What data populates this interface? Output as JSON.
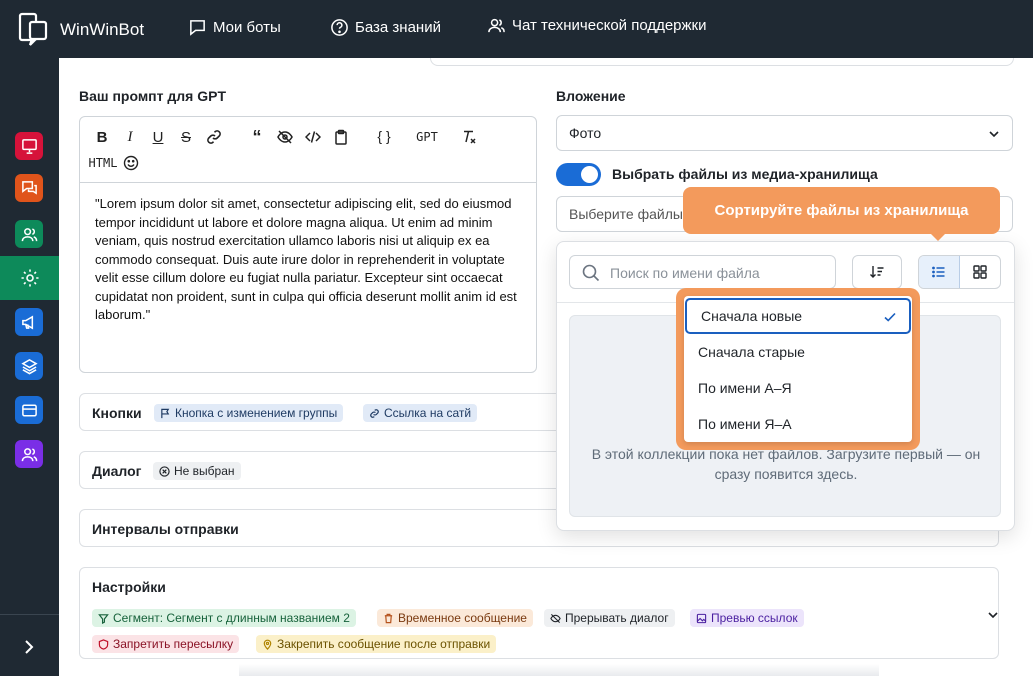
{
  "app": {
    "brand": "WinWinBot"
  },
  "nav": {
    "my_bots": "Мои боты",
    "knowledge_base": "База знаний",
    "support_chat": "Чат технической поддержки"
  },
  "sidebar": {
    "items": [
      {
        "icon": "presentation-icon",
        "color": "#d6123a"
      },
      {
        "icon": "chat-icon",
        "color": "#e0541b"
      },
      {
        "icon": "users-icon",
        "color": "#0d8a5a"
      },
      {
        "icon": "gear-icon",
        "color": "#0d8a5a",
        "active": true
      },
      {
        "icon": "megaphone-icon",
        "color": "#1a6cd6"
      },
      {
        "icon": "layers-icon",
        "color": "#1a6cd6"
      },
      {
        "icon": "card-icon",
        "color": "#1a6cd6"
      },
      {
        "icon": "group-icon",
        "color": "#7a2ee6"
      }
    ]
  },
  "prompt": {
    "label": "Ваш промпт для GPT",
    "toolbar": {
      "gpt_label": "GPT",
      "html_label": "HTML"
    },
    "text": "\"Lorem ipsum dolor sit amet, consectetur adipiscing elit, sed do eiusmod tempor incididunt ut labore et dolore magna aliqua. Ut enim ad minim veniam, quis nostrud exercitation ullamco laboris nisi ut aliquip ex ea commodo consequat. Duis aute irure dolor in reprehenderit in voluptate velit esse cillum dolore eu fugiat nulla pariatur. Excepteur sint occaecat cupidatat non proident, sunt in culpa qui officia deserunt mollit anim id est laborum.\""
  },
  "buttons_row": {
    "title": "Кнопки",
    "chips": [
      "Кнопка с изменением группы",
      "Ссылка на сатй"
    ]
  },
  "dialog_row": {
    "title": "Диалог",
    "chip": "Не выбран"
  },
  "intervals_row": {
    "title": "Интервалы отправки"
  },
  "settings_row": {
    "title": "Настройки",
    "chips": [
      "Сегмент: Сегмент с длинным названием 2",
      "Временное сообщение",
      "Прерывать диалог",
      "Превью ссылок",
      "Запретить пересылку",
      "Закрепить сообщение после отправки"
    ]
  },
  "attachment": {
    "label": "Вложение",
    "value": "Фото",
    "toggle_label": "Выбрать файлы из медиа-хранилища",
    "toggle_on": true,
    "files_placeholder": "Выберите файлы"
  },
  "storage": {
    "search_placeholder": "Поиск по имени файла",
    "empty_text": "В этой коллекции пока нет файлов. Загрузите первый — он сразу появится здесь.",
    "sort_options": [
      "Сначала новые",
      "Сначала старые",
      "По имени А–Я",
      "По имени Я–А"
    ],
    "selected_sort": "Сначала новые"
  },
  "tooltip": {
    "text": "Сортируйте файлы из хранилища"
  }
}
